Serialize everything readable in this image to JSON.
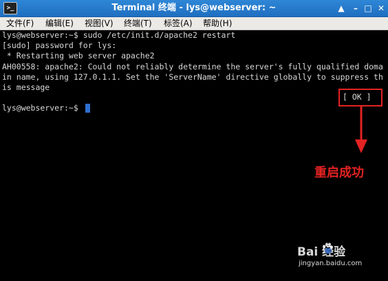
{
  "window": {
    "title": "Terminal 终端 - lys@webserver: ~",
    "controls": {
      "up": "▲",
      "minimize": "–",
      "maximize": "□",
      "close": "✕"
    }
  },
  "menu": {
    "items": [
      {
        "label": "文件(F)"
      },
      {
        "label": "编辑(E)"
      },
      {
        "label": "视图(V)"
      },
      {
        "label": "终端(T)"
      },
      {
        "label": "标签(A)"
      },
      {
        "label": "帮助(H)"
      }
    ]
  },
  "terminal": {
    "lines": [
      "lys@webserver:~$ sudo /etc/init.d/apache2 restart",
      "[sudo] password for lys:",
      " * Restarting web server apache2",
      "AH00558: apache2: Could not reliably determine the server's fully qualified doma",
      "in name, using 127.0.1.1. Set the 'ServerName' directive globally to suppress th",
      "is message",
      "",
      "lys@webserver:~$ "
    ],
    "ok_status": "[ OK ]"
  },
  "annotation": {
    "text": "重启成功",
    "color": "#e32222"
  },
  "watermark": {
    "logo_text": "Bai  经验",
    "url": "jingyan.baidu.com"
  }
}
